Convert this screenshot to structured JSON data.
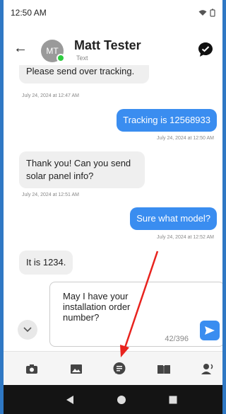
{
  "status_bar": {
    "time": "12:50 AM"
  },
  "header": {
    "avatar_initials": "MT",
    "contact_name": "Matt Tester",
    "contact_subtitle": "Text"
  },
  "messages": [
    {
      "direction": "in",
      "text": "Please send over tracking.",
      "timestamp": "July 24, 2024 at 12:47 AM"
    },
    {
      "direction": "out",
      "text": "Tracking is 12568933",
      "timestamp": "July 24, 2024 at 12:50 AM"
    },
    {
      "direction": "in",
      "text": "Thank you! Can you send solar panel info?",
      "timestamp": "July 24, 2024 at 12:51 AM"
    },
    {
      "direction": "out",
      "text": "Sure what model?",
      "timestamp": "July 24, 2024 at 12:52 AM"
    },
    {
      "direction": "in",
      "text": "It is 1234.",
      "timestamp": ""
    }
  ],
  "composer": {
    "text": "May I have your installation order number?",
    "char_count": "42/396"
  },
  "colors": {
    "frame": "#2f78c4",
    "outgoing_bubble": "#3a8df0",
    "incoming_bubble": "#efefef",
    "annotation_arrow": "#e8231e"
  },
  "icons": {
    "back": "arrow-left-icon",
    "chat": "chat-bubble-icon",
    "collapse": "chevron-down-icon",
    "send": "send-icon",
    "tools": [
      "camera-icon",
      "image-icon",
      "message-icon",
      "book-icon",
      "person-voice-icon"
    ],
    "nav": [
      "nav-back-icon",
      "nav-home-icon",
      "nav-recents-icon"
    ]
  }
}
